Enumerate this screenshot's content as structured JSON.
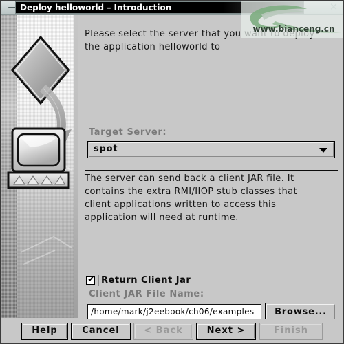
{
  "window": {
    "title": "Deploy helloworld – Introduction",
    "minimize_label": "—",
    "close_label": "✕"
  },
  "watermark": {
    "text": "www.bianceng.cn",
    "logo_icon": "green-leaf-swoosh-icon"
  },
  "sidebar": {
    "graphic_icons": [
      "diamond-shape",
      "curved-arrow",
      "computer-monitor"
    ]
  },
  "panel": {
    "intro_text": "Please select the server that you want to deploy\nthe application helloworld to",
    "target_server_label": "Target Server:",
    "target_server_value": "spot",
    "jar_description": "The server can send back a client JAR file. It\ncontains the extra RMI/IIOP stub classes that\nclient applications written to access this\napplication will need at runtime.",
    "return_client_jar_label": "Return Client Jar",
    "return_client_jar_checked": "✔",
    "client_jar_name_label": "Client JAR File Name:",
    "client_jar_path": "/home/mark/j2eebook/ch06/examples",
    "browse_label": "Browse..."
  },
  "buttons": {
    "help": "Help",
    "cancel": "Cancel",
    "back": "< Back",
    "next": "Next >",
    "finish": "Finish"
  },
  "colors": {
    "panel_background": "#c8c8c8",
    "titlebar_plate": "#000000",
    "text": "#0c0c0c",
    "dim_text": "#7a7a7a",
    "watermark_green": "#7fae82"
  }
}
